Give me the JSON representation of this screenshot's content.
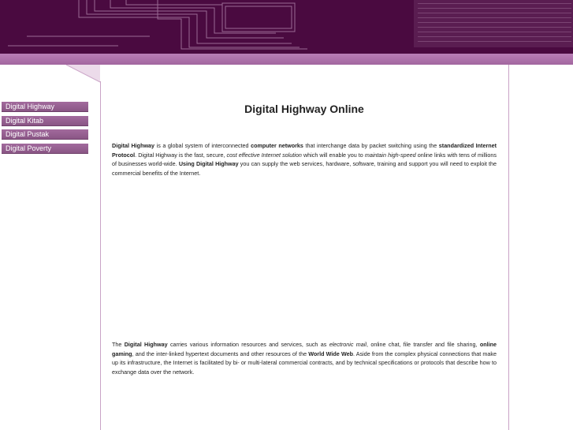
{
  "header": {
    "brand_color": "#4a0a40",
    "accent_color": "#a2669f"
  },
  "sidebar": {
    "items": [
      {
        "label": "Digital Highway"
      },
      {
        "label": "Digital Kitab"
      },
      {
        "label": "Digital Pustak"
      },
      {
        "label": "Digital Poverty"
      }
    ]
  },
  "main": {
    "title": "Digital Highway Online",
    "para1": {
      "s1": "Digital Highway",
      "s2": " is a global system of interconnected ",
      "s3": "computer networks",
      "s4": " that interchange data by packet switching using the ",
      "s5": "standardized Internet Protocol",
      "s6": ". Digital Highway is the fast, secure, ",
      "s7": "cost effective Internet solution",
      "s8": " which will enable you to ",
      "s9": "maintain high-speed",
      "s10": " online links with tens of millions of businesses world-wide. ",
      "s11": "Using Digital Highway",
      "s12": " you can supply the web services, hardware, software, training and support you will need to exploit the commercial benefits of the Internet."
    },
    "para2": {
      "s1": "The ",
      "s2": "Digital Highway",
      "s3": " carries various information resources and services, such as ",
      "s4": "electronic mail",
      "s5": ", online chat, file transfer and file sharing, ",
      "s6": "online gaming",
      "s7": ", and the inter-linked hypertext documents and other resources of the ",
      "s8": "World Wide Web",
      "s9": ". Aside from the complex physical connections that make up its infrastructure, the Internet is facilitated by bi- or multi-lateral commercial contracts, and by technical specifications or protocols that describe how to exchange data over the network."
    }
  }
}
